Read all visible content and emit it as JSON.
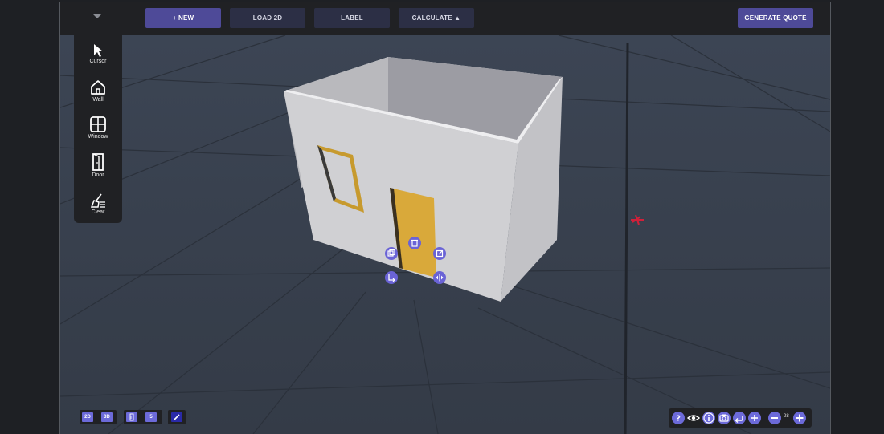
{
  "toolbar": {
    "new_label": "+ NEW",
    "load_label": "LOAD 2D",
    "label_label": "LABEL",
    "calculate_label": "CALCULATE ▲",
    "quote_label": "GENERATE QUOTE"
  },
  "tools": [
    {
      "label": "Cursor",
      "icon": "cursor-icon"
    },
    {
      "label": "Wall",
      "icon": "house-icon"
    },
    {
      "label": "Window",
      "icon": "window-icon"
    },
    {
      "label": "Door",
      "icon": "door-icon"
    },
    {
      "label": "Clear",
      "icon": "broom-icon"
    }
  ],
  "view_controls": {
    "mode_2d": "2D",
    "mode_3d": "3D",
    "number_label": "5"
  },
  "zoom": {
    "level": "28"
  },
  "colors": {
    "accent": "#6c6ad9",
    "primary_button": "#4e4a98",
    "door": "#d9a93a",
    "wall": "#cfcfd2",
    "background": "#3a4250"
  }
}
